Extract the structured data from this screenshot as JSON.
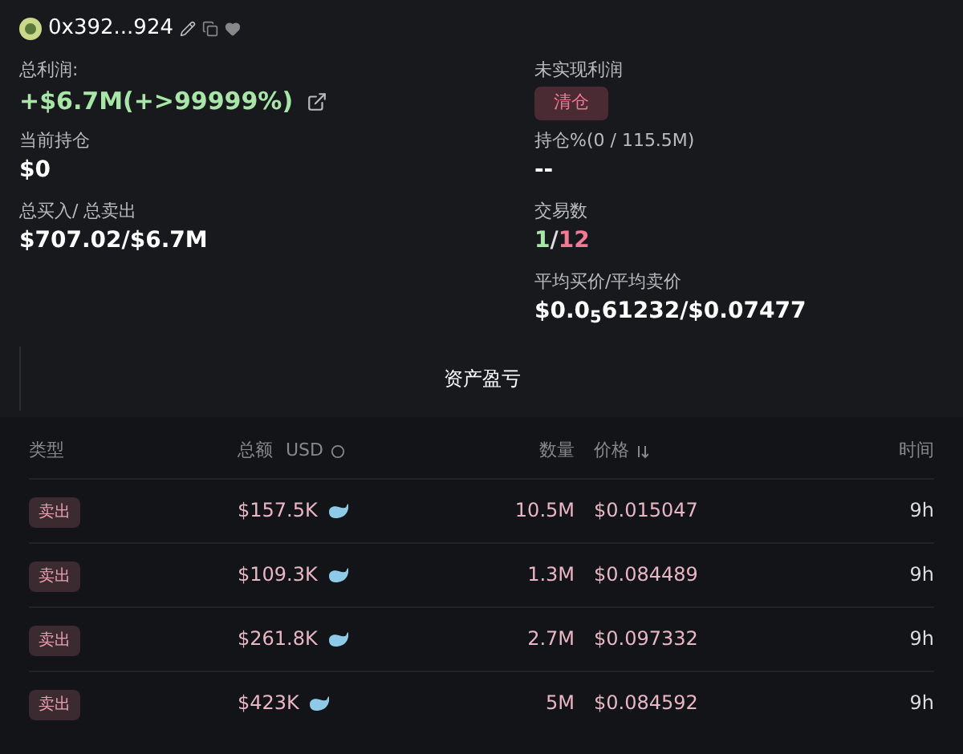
{
  "header": {
    "address": "0x392...924"
  },
  "left_stats": [
    {
      "label": "总利润:",
      "value": "+$6.7M(+>99999%)",
      "kind": "profit"
    },
    {
      "label": "当前持仓",
      "value": "$0",
      "kind": "plain"
    },
    {
      "label": "总买入/ 总卖出",
      "value": "$707.02/$6.7M",
      "kind": "plain"
    }
  ],
  "right_stats": [
    {
      "label": "未实现利润",
      "value": "清仓",
      "kind": "badge"
    },
    {
      "label": "持仓%(0 / 115.5M)",
      "value": "--",
      "kind": "plain"
    },
    {
      "label": "交易数",
      "buys": "1",
      "separator": "/",
      "sells": "12",
      "kind": "trades"
    },
    {
      "label": "平均买价/平均卖价",
      "value": "$0.0$_{5}$61232/$0.07477",
      "kind": "plain"
    }
  ],
  "section_title": "资产盈亏",
  "table": {
    "columns": [
      "类型",
      "总额",
      "USD",
      "数量",
      "价格",
      "时间"
    ],
    "rows": [
      {
        "type": "卖出",
        "amount": "$157.5K",
        "quantity": "10.5M",
        "price": "$0.015047",
        "time": "9h"
      },
      {
        "type": "卖出",
        "amount": "$109.3K",
        "quantity": "1.3M",
        "price": "$0.084489",
        "time": "9h"
      },
      {
        "type": "卖出",
        "amount": "$261.8K",
        "quantity": "2.7M",
        "price": "$0.097332",
        "time": "9h"
      },
      {
        "type": "卖出",
        "amount": "$423K",
        "quantity": "5M",
        "price": "$0.084592",
        "time": "9h"
      }
    ]
  }
}
